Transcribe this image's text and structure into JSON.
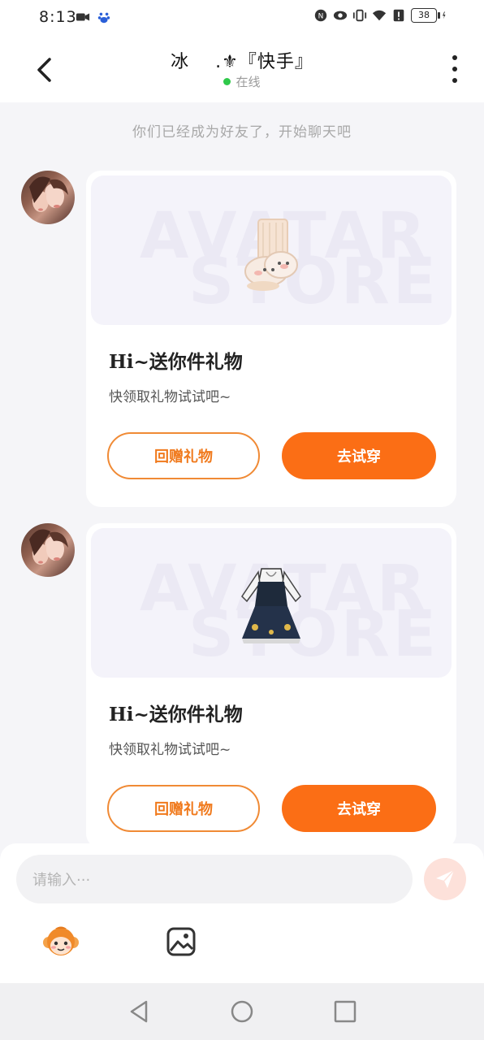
{
  "status_bar": {
    "time": "8:13",
    "battery": "38",
    "icons": [
      "video-icon",
      "baidu-icon",
      "nfc-icon",
      "eye-icon",
      "vibrate-icon",
      "wifi-icon",
      "alert-icon",
      "battery-icon",
      "charging-icon"
    ]
  },
  "header": {
    "name_prefix": "冰",
    "name_suffix": ".⚜『快手』",
    "status": "在线"
  },
  "system_message": "你们已经成为好友了，开始聊天吧",
  "messages": [
    {
      "watermark_line1": "AVATAR",
      "watermark_line2": "STORE",
      "gift_item": "socks",
      "title": "Hi~送你件礼物",
      "subtitle": "快领取礼物试试吧~",
      "return_gift_label": "回赠礼物",
      "try_on_label": "去试穿"
    },
    {
      "watermark_line1": "AVATAR",
      "watermark_line2": "STORE",
      "gift_item": "dress",
      "title": "Hi~送你件礼物",
      "subtitle": "快领取礼物试试吧~",
      "return_gift_label": "回赠礼物",
      "try_on_label": "去试穿"
    }
  ],
  "input": {
    "placeholder": "请输入···"
  },
  "colors": {
    "accent": "#fb6e15",
    "outline": "#f08a35",
    "online": "#2fc94a",
    "background": "#f5f5f8"
  }
}
